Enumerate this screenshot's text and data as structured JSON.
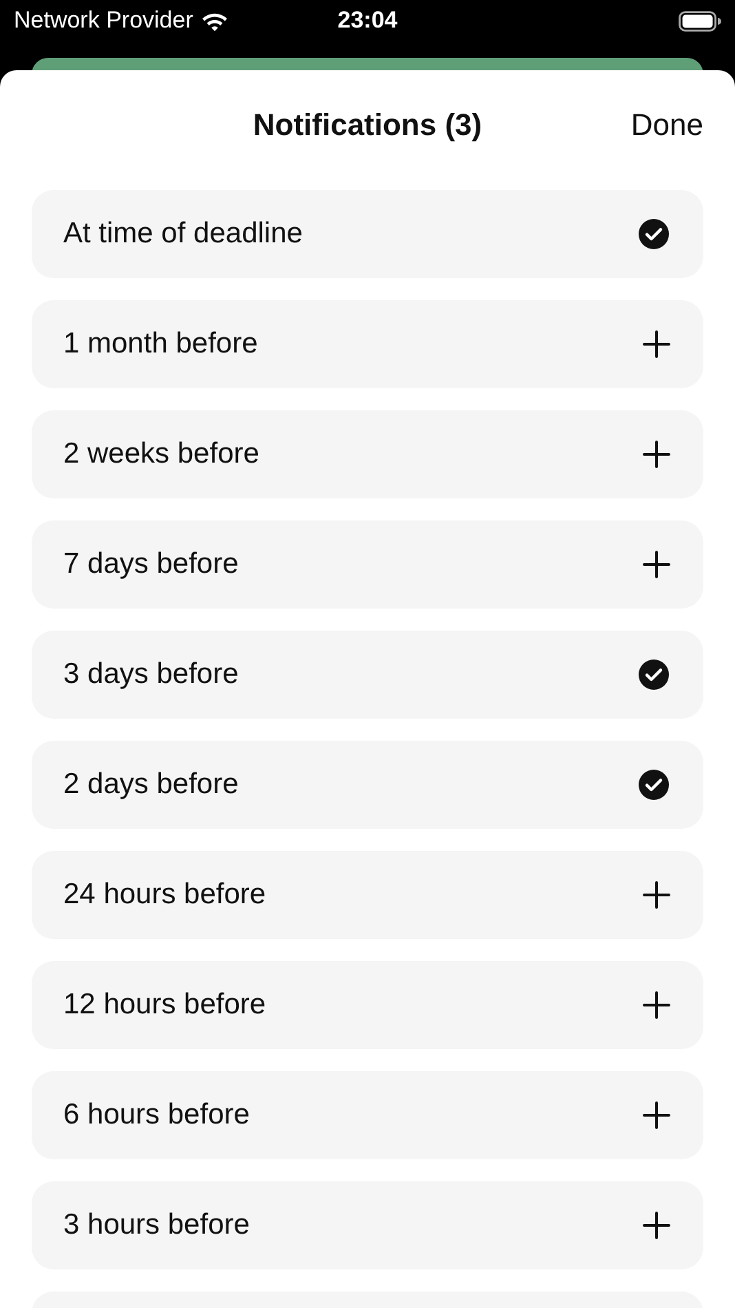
{
  "status_bar": {
    "carrier": "Network Provider",
    "time": "23:04"
  },
  "header": {
    "title": "Notifications (3)",
    "done": "Done"
  },
  "options": [
    {
      "label": "At time of deadline",
      "selected": true
    },
    {
      "label": "1 month before",
      "selected": false
    },
    {
      "label": "2 weeks before",
      "selected": false
    },
    {
      "label": "7 days before",
      "selected": false
    },
    {
      "label": "3 days before",
      "selected": true
    },
    {
      "label": "2 days before",
      "selected": true
    },
    {
      "label": "24 hours before",
      "selected": false
    },
    {
      "label": "12 hours before",
      "selected": false
    },
    {
      "label": "6 hours before",
      "selected": false
    },
    {
      "label": "3 hours before",
      "selected": false
    }
  ]
}
